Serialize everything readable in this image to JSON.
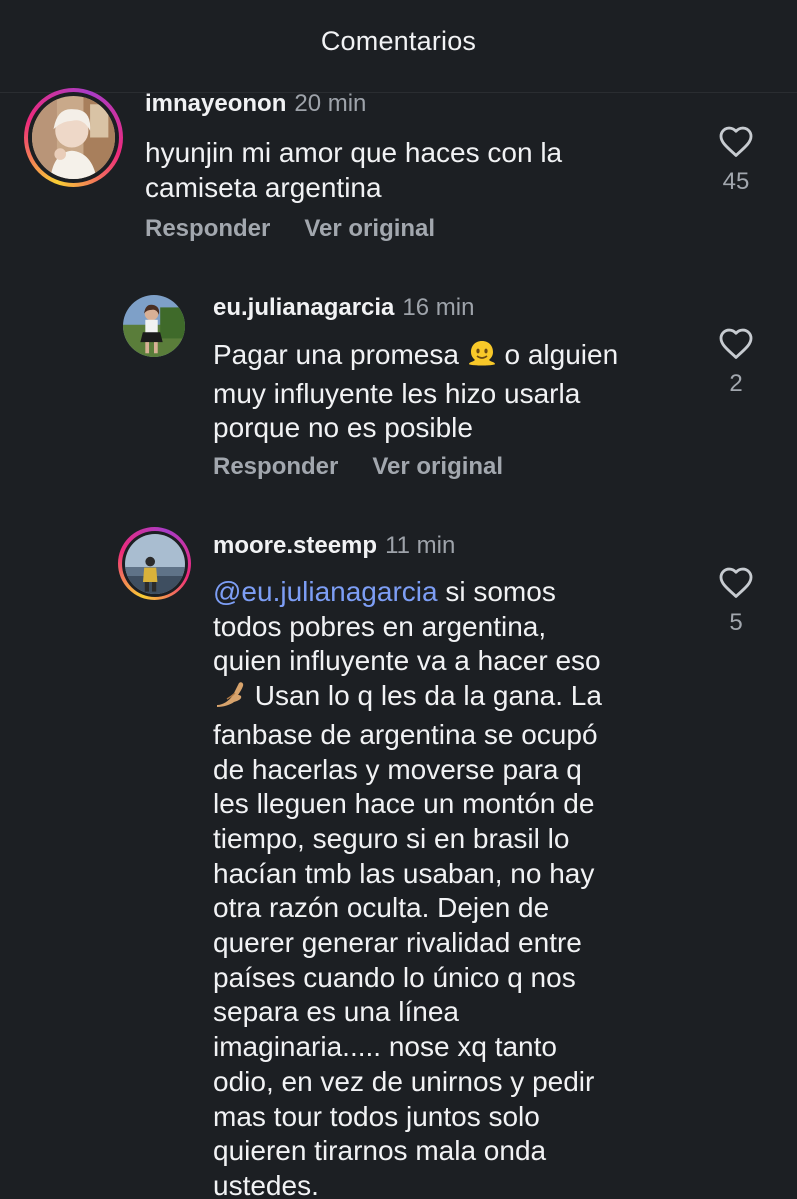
{
  "header": {
    "title": "Comentarios"
  },
  "comments": [
    {
      "username": "imnayeonon",
      "time": "20 min",
      "text_lines": [
        "hyunjin mi amor que haces con la",
        "camiseta argentina"
      ],
      "reply_label": "Responder",
      "original_label": "Ver original",
      "likes": "45"
    },
    {
      "username": "eu.julianagarcia",
      "time": "16 min",
      "text_lines": [
        "Pagar una promesa",
        "o alguien",
        "muy influyente les hizo usarla",
        "porque no es posible"
      ],
      "reply_label": "Responder",
      "original_label": "Ver original",
      "likes": "2"
    },
    {
      "username": "moore.steemp",
      "time": "11 min",
      "mention": "@eu.julianagarcia",
      "text_lines": [
        "si somos",
        "todos pobres en argentina,",
        "quien influyente va a hacer eso",
        "Usan lo q les da la gana. La",
        "fanbase de argentina se ocupó",
        "de hacerlas y moverse para q",
        "les lleguen hace un montón de",
        "tiempo, seguro si en brasil lo",
        "hacían tmb las usaban, no hay",
        "otra razón oculta. Dejen de",
        "querer generar rivalidad entre",
        "países cuando lo único q nos",
        "separa es una línea",
        "imaginaria..... nose xq tanto",
        "odio, en vez de unirnos y pedir",
        "mas tour todos juntos solo",
        "quieren tirarnos mala onda",
        "ustedes."
      ],
      "likes": "5"
    }
  ]
}
